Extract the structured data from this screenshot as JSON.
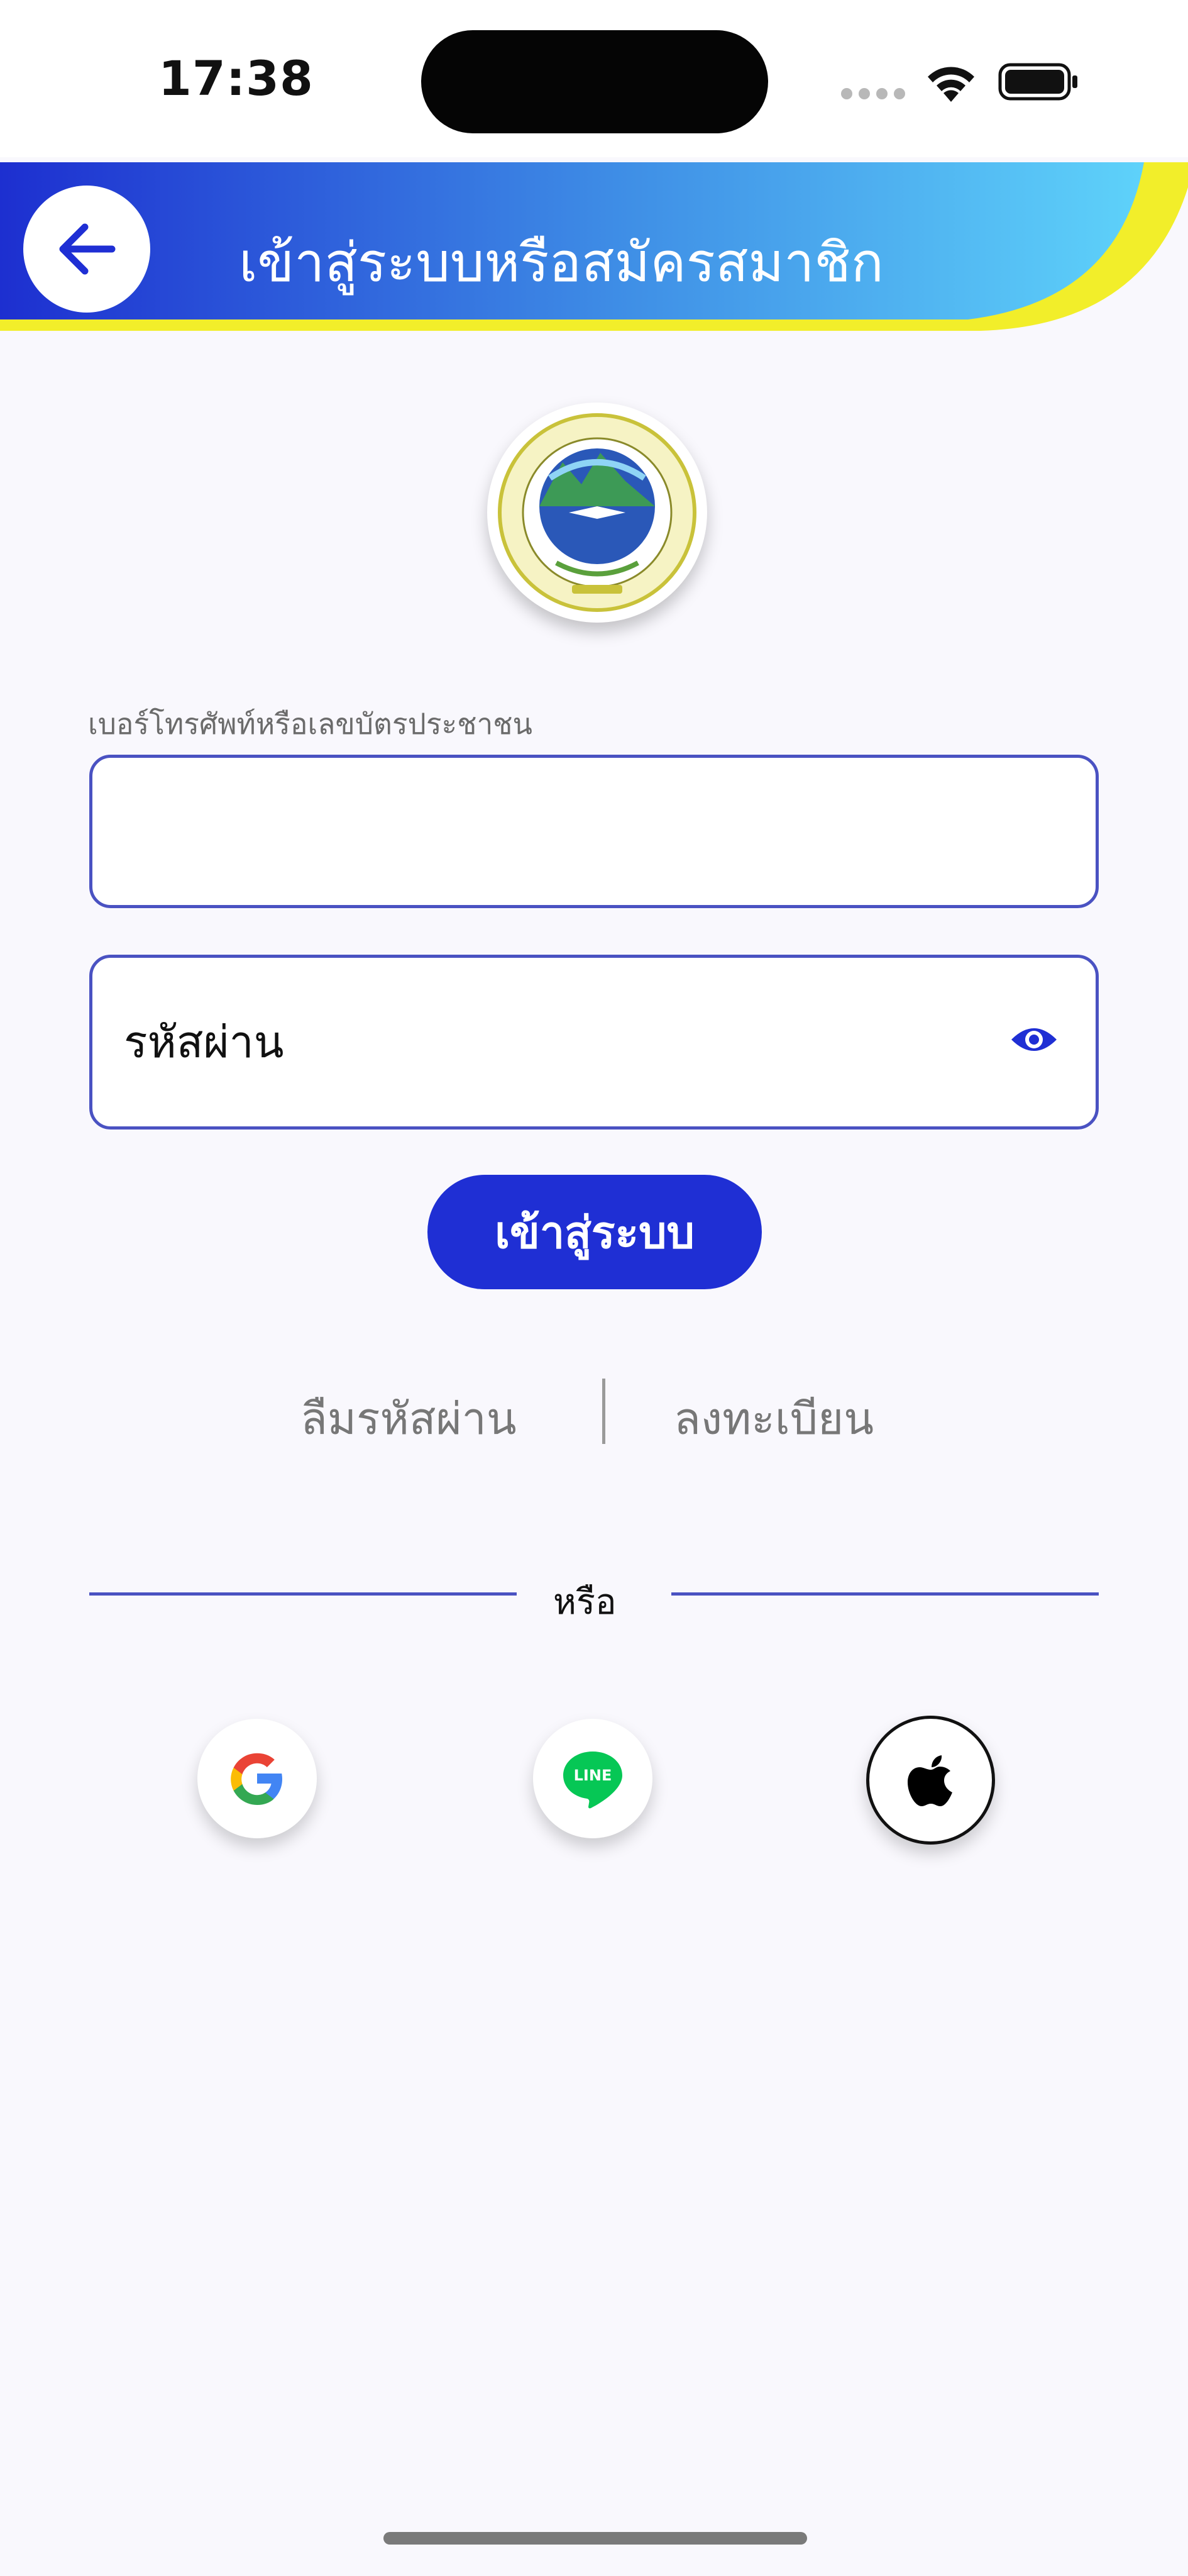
{
  "status_bar": {
    "time": "17:38"
  },
  "header": {
    "title": "เข้าสู่ระบบหรือสมัครสมาชิก",
    "back_icon": "arrow-left-icon"
  },
  "colors": {
    "primary": "#1f2fd4",
    "header_gradient_start": "#1d2fd0",
    "header_gradient_end": "#5ed2fa",
    "accent_yellow": "#f2ee2a",
    "field_border": "#4a52c2"
  },
  "form": {
    "phone_label": "เบอร์โทรศัพท์หรือเลขบัตรประชาชน",
    "phone_value": "",
    "password_placeholder": "รหัสผ่าน",
    "login_button": "เข้าสู่ระบบ"
  },
  "links": {
    "forgot_password": "ลืมรหัสผ่าน",
    "register": "ลงทะเบียน"
  },
  "divider": {
    "or_text": "หรือ"
  },
  "social": [
    {
      "name": "Google",
      "icon": "google-icon"
    },
    {
      "name": "LINE",
      "icon": "line-icon",
      "label": "LINE"
    },
    {
      "name": "Apple",
      "icon": "apple-icon"
    }
  ]
}
